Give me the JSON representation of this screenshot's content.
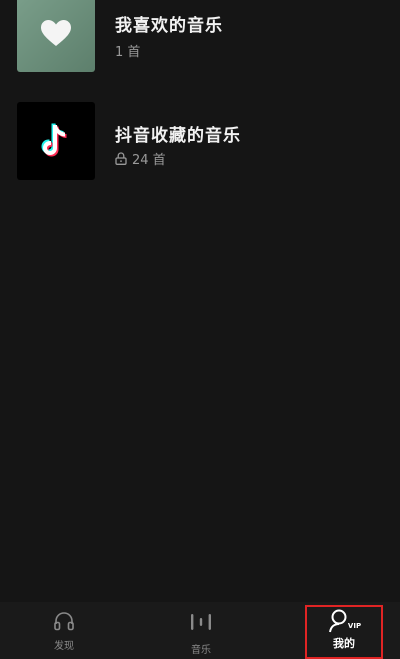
{
  "playlists": [
    {
      "title": "我喜欢的音乐",
      "count": "1 首",
      "cover_icon": "heart-icon"
    },
    {
      "title": "抖音收藏的音乐",
      "count": "24 首",
      "cover_icon": "tiktok-logo",
      "lock_icon": "lock-icon"
    }
  ],
  "tabbar": {
    "discover_label": "发现",
    "music_label": "音乐",
    "mine_label": "我的",
    "mine_badge": "VIP"
  },
  "colors": {
    "background": "#151515",
    "highlight": "#e02424",
    "liked_cover": "#6f9380"
  }
}
